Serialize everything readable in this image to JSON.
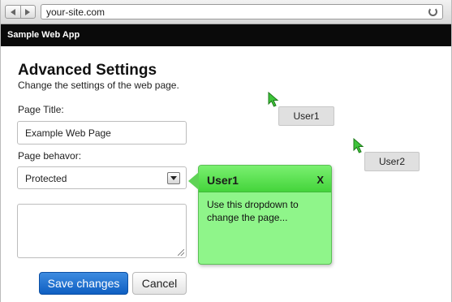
{
  "browser": {
    "url": "your-site.com",
    "back_icon": "back-arrow-icon",
    "forward_icon": "forward-arrow-icon",
    "reload_icon": "reload-icon"
  },
  "app": {
    "title": "Sample Web App"
  },
  "settings": {
    "heading": "Advanced Settings",
    "subheading": "Change the settings of the web page.",
    "page_title_label": "Page Title:",
    "page_title_value": "Example Web Page",
    "page_behavior_label": "Page behavor:",
    "page_behavior_value": "Protected",
    "notes_value": "",
    "save_label": "Save changes",
    "cancel_label": "Cancel"
  },
  "users": [
    {
      "name": "User1",
      "cursor_color": "#3ec43a"
    },
    {
      "name": "User2",
      "cursor_color": "#3ec43a"
    }
  ],
  "tooltip": {
    "title": "User1",
    "close_label": "X",
    "body": "Use this dropdown to change the page...",
    "color": "#8ff58a"
  }
}
